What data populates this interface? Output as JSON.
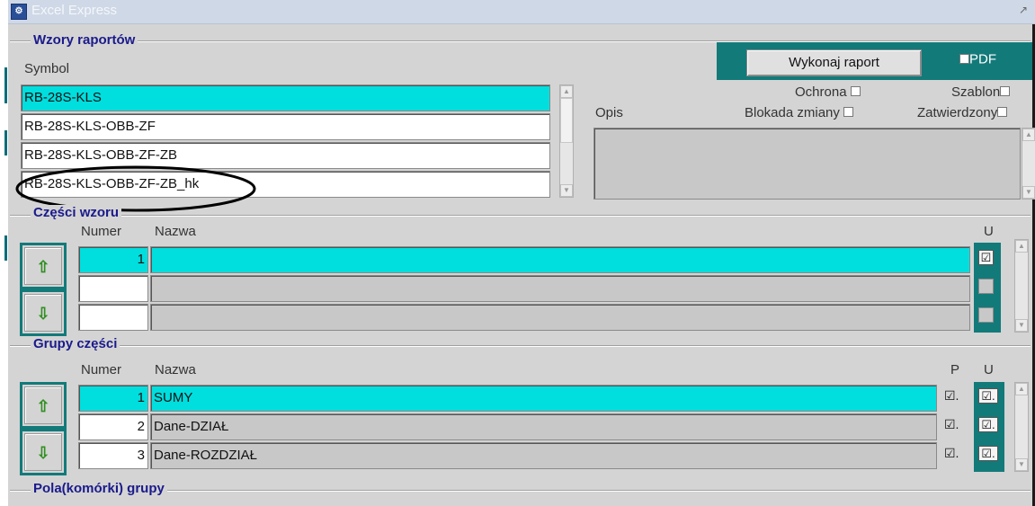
{
  "window": {
    "title": "Excel Express"
  },
  "wzory": {
    "section_title": "Wzory raportów",
    "symbol_label": "Symbol",
    "items": [
      "RB-28S-KLS",
      "RB-28S-KLS-OBB-ZF",
      "RB-28S-KLS-OBB-ZF-ZB",
      "RB-28S-KLS-OBB-ZF-ZB_hk"
    ],
    "opis_label": "Opis",
    "ochrona_label": "Ochrona",
    "szablon_label": "Szablon",
    "blokada_label": "Blokada zmiany",
    "zatwierdzony_label": "Zatwierdzony",
    "run_button": "Wykonaj raport",
    "pdf_label": "PDF"
  },
  "czesci": {
    "section_title": "Części wzoru",
    "numer_header": "Numer",
    "nazwa_header": "Nazwa",
    "u_header": "U",
    "rows": [
      {
        "numer": "1",
        "nazwa": "",
        "u": true
      },
      {
        "numer": "",
        "nazwa": "",
        "u": false
      },
      {
        "numer": "",
        "nazwa": "",
        "u": false
      }
    ]
  },
  "grupy": {
    "section_title": "Grupy części",
    "numer_header": "Numer",
    "nazwa_header": "Nazwa",
    "p_header": "P",
    "u_header": "U",
    "rows": [
      {
        "numer": "1",
        "nazwa": "SUMY",
        "p": true,
        "u": true
      },
      {
        "numer": "2",
        "nazwa": "Dane-DZIAŁ",
        "p": true,
        "u": true
      },
      {
        "numer": "3",
        "nazwa": "Dane-ROZDZIAŁ",
        "p": true,
        "u": true
      }
    ]
  },
  "pola": {
    "section_title": "Pola(komórki) grupy"
  },
  "icons": {
    "up": "green-up-arrow-icon",
    "down": "green-down-arrow-icon",
    "check": "checkmark-icon"
  },
  "colors": {
    "accent_teal": "#137a7a",
    "selected_cyan": "#00dede",
    "section_title": "#1a1a8c"
  }
}
